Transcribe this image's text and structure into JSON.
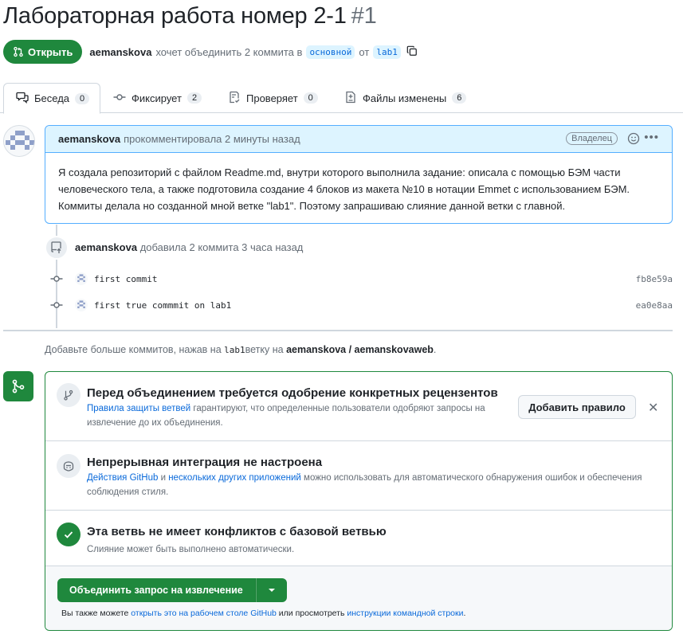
{
  "header": {
    "title": "Лабораторная работа номер 2-1",
    "number": "#1"
  },
  "state": {
    "badge_label": "Открыть",
    "author": "aemanskova",
    "text_merge": "хочет объединить 2 коммита в",
    "base_branch": "основной",
    "text_from": "от",
    "head_branch": "lab1"
  },
  "tabs": [
    {
      "label": "Беседа",
      "count": "0",
      "icon": "comment-discussion-icon"
    },
    {
      "label": "Фиксирует",
      "count": "2",
      "icon": "git-commit-icon"
    },
    {
      "label": "Проверяет",
      "count": "0",
      "icon": "checklist-icon"
    },
    {
      "label": "Файлы изменены",
      "count": "6",
      "icon": "file-diff-icon"
    }
  ],
  "comment": {
    "author": "aemanskova",
    "meta": "прокомментировала 2 минуты назад",
    "badge": "Владелец",
    "body": "Я создала репозиторий с файлом Readme.md, внутри которого выполнила задание: описала с помощью БЭМ части человеческого тела, а также подготовила создание 4 блоков из макета №10 в нотации Emmet с использованием БЭМ. Коммиты делала но созданной мной ветке \"lab1\". Поэтому запрашиваю слияние данной ветки с главной."
  },
  "push_event": {
    "author": "aemanskova",
    "text": "добавила 2 коммита 3 часа назад"
  },
  "commits": [
    {
      "message": "first commit",
      "sha": "fb8e59a"
    },
    {
      "message": "first true commmit on lab1",
      "sha": "ea0e8aa"
    }
  ],
  "hint": {
    "prefix": "Добавьте больше коммитов, нажав на",
    "branch": "lab1",
    "middle": "ветку на",
    "repo": "aemanskova / aemanskovaweb",
    "suffix": "."
  },
  "merge_box": {
    "review": {
      "title": "Перед объединением требуется одобрение конкретных рецензентов",
      "link": "Правила защиты ветвей",
      "desc": " гарантируют, что определенные пользователи одобряют запросы на извлечение до их объединения.",
      "button": "Добавить правило"
    },
    "ci": {
      "title": "Непрерывная интеграция не настроена",
      "link1": "Действия GitHub",
      "and": " и ",
      "link2": "нескольких других приложений",
      "desc": " можно использовать для автоматического обнаружения ошибок и обеспечения соблюдения стиля."
    },
    "conflicts": {
      "title": "Эта ветвь не имеет конфликтов с базовой ветвью",
      "desc": "Слияние может быть выполнено автоматически."
    },
    "merge_button": "Объединить запрос на извлечение",
    "footer": {
      "prefix": "Вы также можете ",
      "link1": "открыть это на рабочем столе GitHub",
      "middle": " или просмотреть ",
      "link2": "инструкции командной строки",
      "suffix": "."
    }
  },
  "colors": {
    "green": "#1f883d",
    "blue_link": "#0969da",
    "comment_header": "#ddf4ff"
  }
}
